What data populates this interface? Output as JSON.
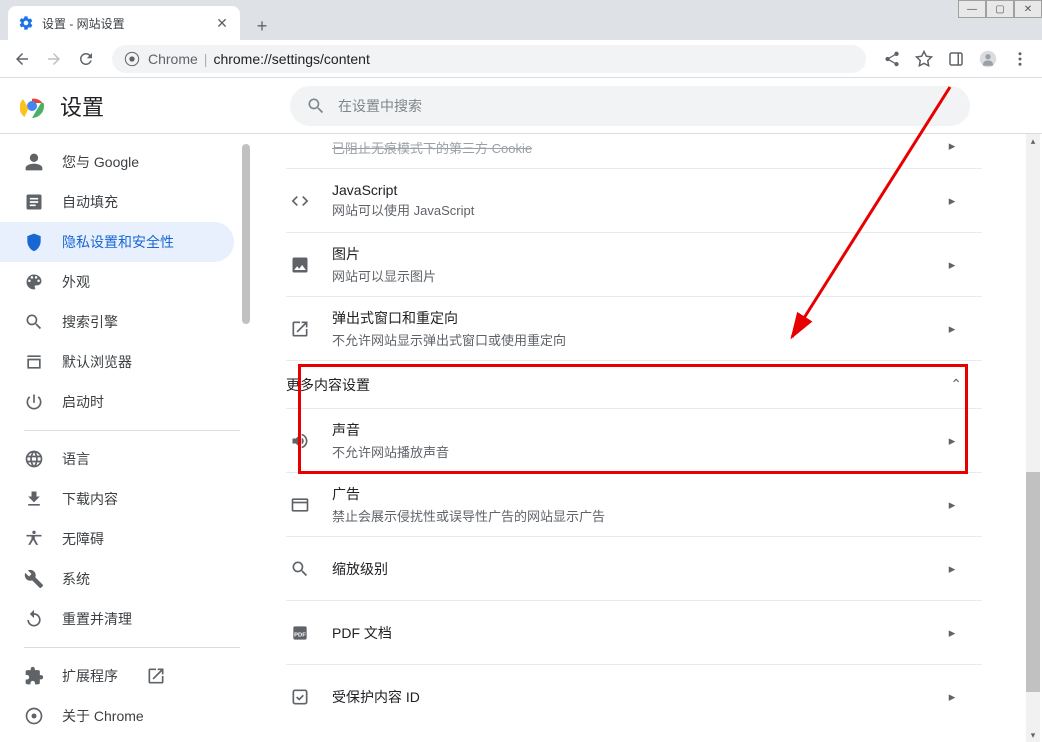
{
  "window": {
    "minimize": "—",
    "maximize": "▢",
    "close": "✕"
  },
  "tab": {
    "title": "设置 - 网站设置"
  },
  "toolbar": {
    "url_scheme": "Chrome",
    "url_path": "chrome://settings/content"
  },
  "header": {
    "title": "设置",
    "search_placeholder": "在设置中搜索"
  },
  "sidebar": {
    "items": [
      {
        "label": "您与 Google"
      },
      {
        "label": "自动填充"
      },
      {
        "label": "隐私设置和安全性"
      },
      {
        "label": "外观"
      },
      {
        "label": "搜索引擎"
      },
      {
        "label": "默认浏览器"
      },
      {
        "label": "启动时"
      },
      {
        "label": "语言"
      },
      {
        "label": "下载内容"
      },
      {
        "label": "无障碍"
      },
      {
        "label": "系统"
      },
      {
        "label": "重置并清理"
      },
      {
        "label": "扩展程序"
      },
      {
        "label": "关于 Chrome"
      }
    ]
  },
  "content": {
    "partial_row": {
      "sub": "已阻止无痕模式下的第三方 Cookie"
    },
    "rows_top": [
      {
        "title": "JavaScript",
        "sub": "网站可以使用 JavaScript"
      },
      {
        "title": "图片",
        "sub": "网站可以显示图片"
      },
      {
        "title": "弹出式窗口和重定向",
        "sub": "不允许网站显示弹出式窗口或使用重定向"
      }
    ],
    "section_header": "更多内容设置",
    "rows_more": [
      {
        "title": "声音",
        "sub": "不允许网站播放声音"
      },
      {
        "title": "广告",
        "sub": "禁止会展示侵扰性或误导性广告的网站显示广告"
      },
      {
        "title": "缩放级别",
        "sub": ""
      },
      {
        "title": "PDF 文档",
        "sub": ""
      },
      {
        "title": "受保护内容 ID",
        "sub": ""
      }
    ]
  }
}
